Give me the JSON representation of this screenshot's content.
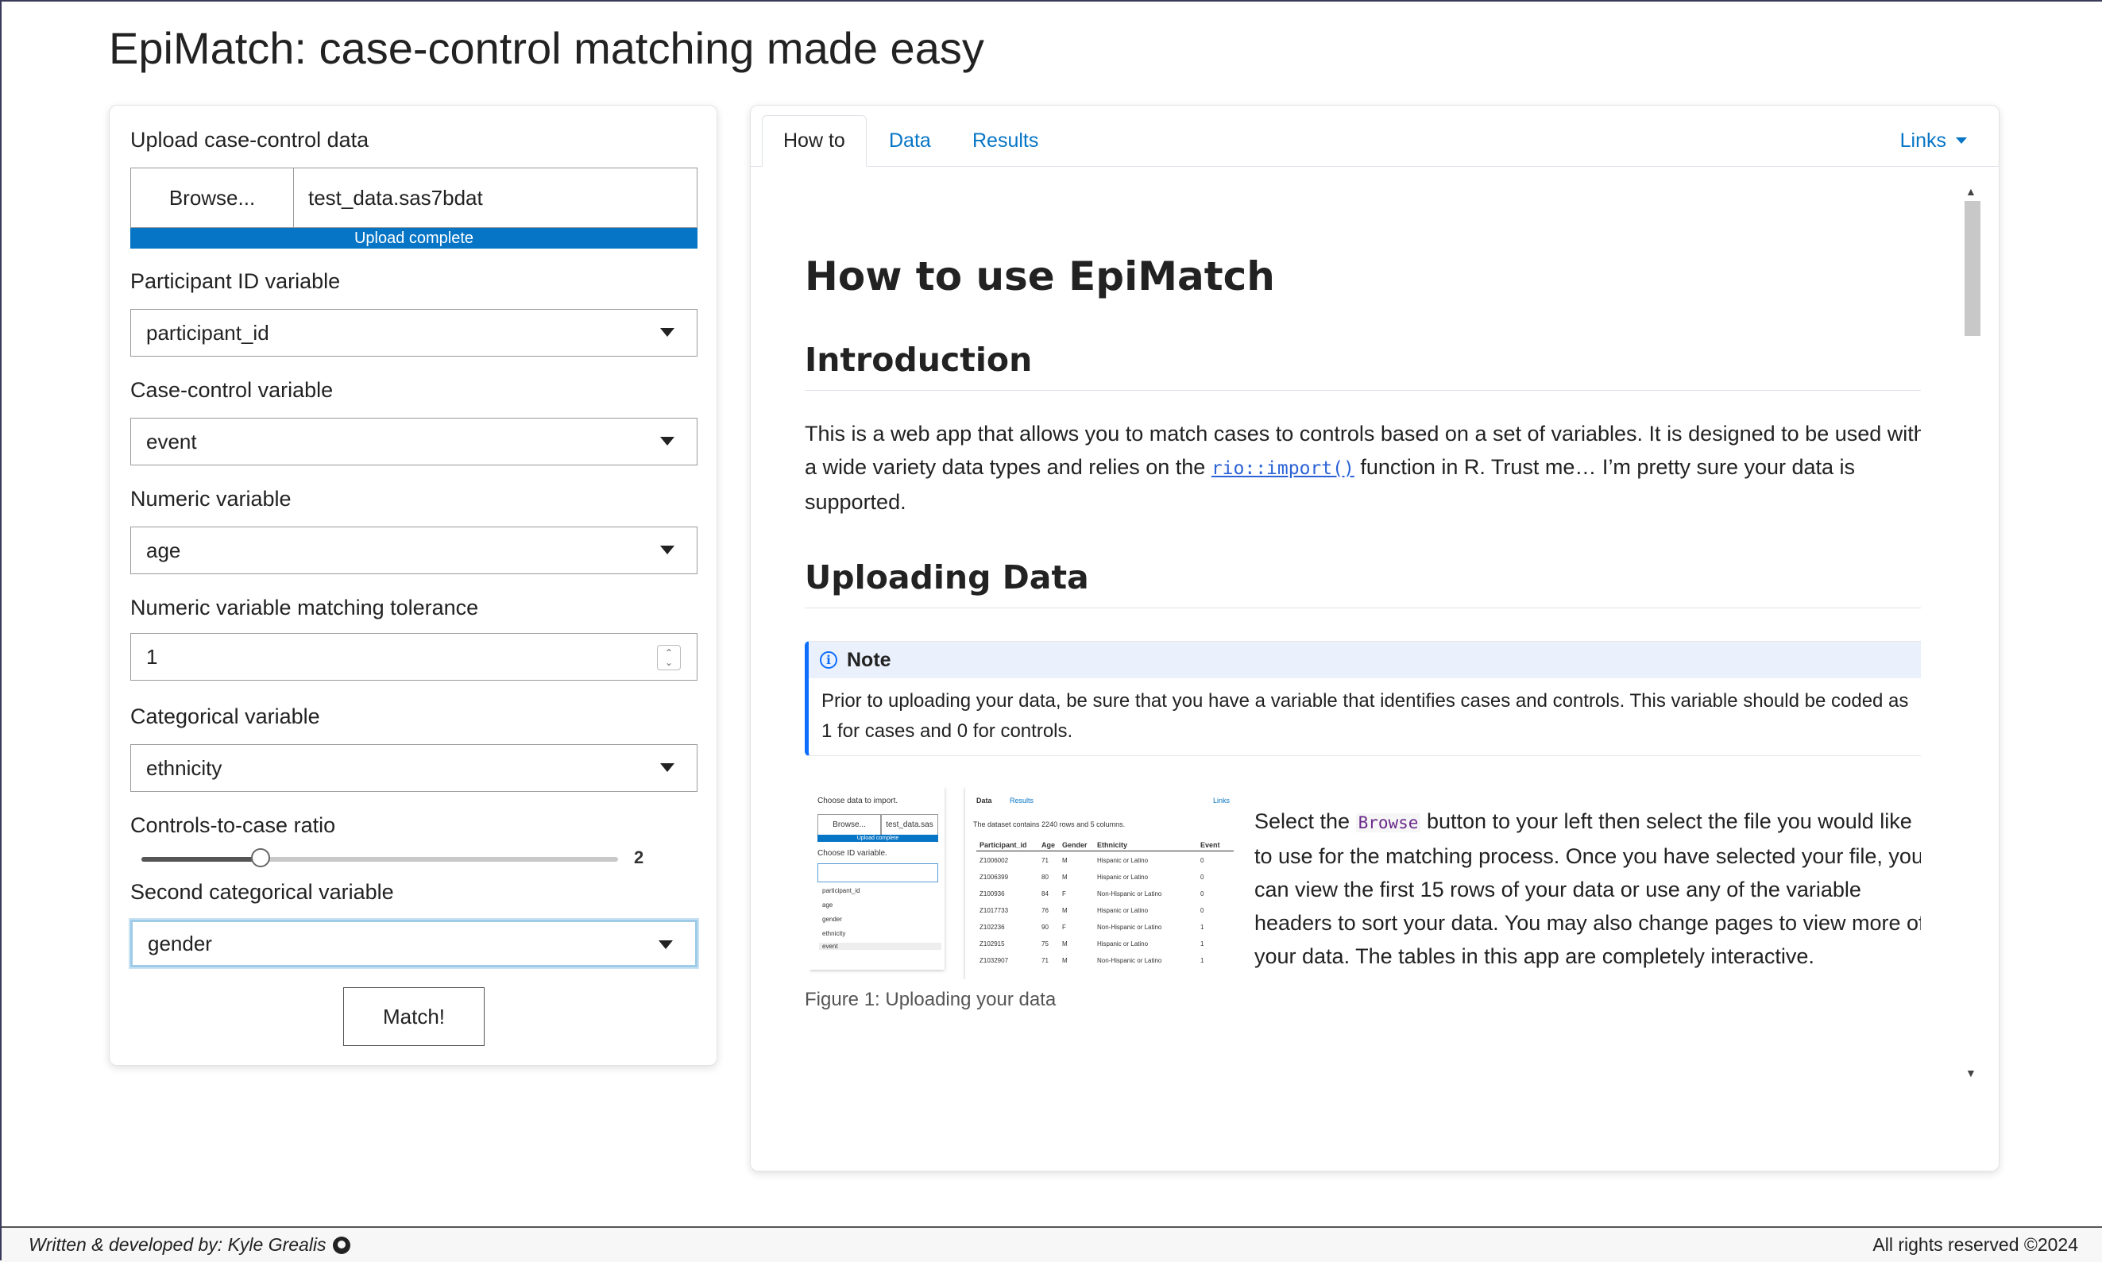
{
  "app": {
    "title": "EpiMatch: case-control matching made easy"
  },
  "sidebar": {
    "upload_label": "Upload case-control data",
    "browse_label": "Browse...",
    "file_name": "test_data.sas7bdat",
    "upload_status": "Upload complete",
    "upload_progress": 1.0,
    "participant_id_label": "Participant ID variable",
    "participant_id_value": "participant_id",
    "case_control_label": "Case-control variable",
    "case_control_value": "event",
    "numeric_label": "Numeric variable",
    "numeric_value": "age",
    "tolerance_label": "Numeric variable matching tolerance",
    "tolerance_value": "1",
    "categorical_label": "Categorical variable",
    "categorical_value": "ethnicity",
    "ratio_label": "Controls-to-case ratio",
    "ratio_value": "2",
    "ratio_fraction": 0.25,
    "second_categorical_label": "Second categorical variable",
    "second_categorical_value": "gender",
    "match_button": "Match!"
  },
  "tabs": [
    {
      "label": "How to",
      "active": true
    },
    {
      "label": "Data",
      "active": false
    },
    {
      "label": "Results",
      "active": false
    }
  ],
  "links_menu": "Links",
  "doc": {
    "h1": "How to use EpiMatch",
    "intro_heading": "Introduction",
    "intro_text_1": "This is a web app that allows you to match cases to controls based on a set of variables. It is designed to be used with a wide variety data types and relies on the ",
    "intro_code": "rio::import()",
    "intro_text_2": " function in R. Trust me… I’m pretty sure your data is supported.",
    "upload_heading": "Uploading Data",
    "note_title": "Note",
    "note_text": "Prior to uploading your data, be sure that you have a variable that identifies cases and controls. This variable should be coded as 1 for cases and 0 for controls.",
    "figure_text_1": "Select the ",
    "figure_code": "Browse",
    "figure_text_2": " button to your left then select the file you would like to use for the matching process. Once you have selected your file, you can view the first 15 rows of your data or use any of the variable headers to sort your data. You may also change pages to view more of your data. The tables in this app are completely interactive.",
    "figure_caption": "Figure 1: Uploading your data"
  },
  "figure_thumb": {
    "left": {
      "choose_label": "Choose data to import.",
      "browse": "Browse...",
      "file": "test_data.sas",
      "status": "Upload complete",
      "id_label": "Choose ID variable.",
      "options": [
        "participant_id",
        "age",
        "gender",
        "ethnicity",
        "event"
      ]
    },
    "right": {
      "tab_data": "Data",
      "tab_results": "Results",
      "links": "Links",
      "summary": "The dataset contains 2240 rows and 5 columns.",
      "headers": [
        "Participant_id",
        "Age",
        "Gender",
        "Ethnicity",
        "Event"
      ],
      "rows": [
        [
          "Z1006002",
          "71",
          "M",
          "Hispanic or Latino",
          "0"
        ],
        [
          "Z1006399",
          "80",
          "M",
          "Hispanic or Latino",
          "0"
        ],
        [
          "Z100936",
          "84",
          "F",
          "Non-Hispanic or Latino",
          "0"
        ],
        [
          "Z1017733",
          "76",
          "M",
          "Hispanic or Latino",
          "0"
        ],
        [
          "Z102236",
          "90",
          "F",
          "Non-Hispanic or Latino",
          "1"
        ],
        [
          "Z102915",
          "75",
          "M",
          "Hispanic or Latino",
          "1"
        ],
        [
          "Z1032907",
          "71",
          "M",
          "Non-Hispanic or Latino",
          "1"
        ]
      ]
    }
  },
  "footer": {
    "credit": "Written & developed by: Kyle Grealis",
    "rights": "All rights reserved ©2024"
  },
  "colors": {
    "accent": "#0675c6",
    "note_border": "#0d6efd",
    "note_bg": "#eaf1fc"
  }
}
